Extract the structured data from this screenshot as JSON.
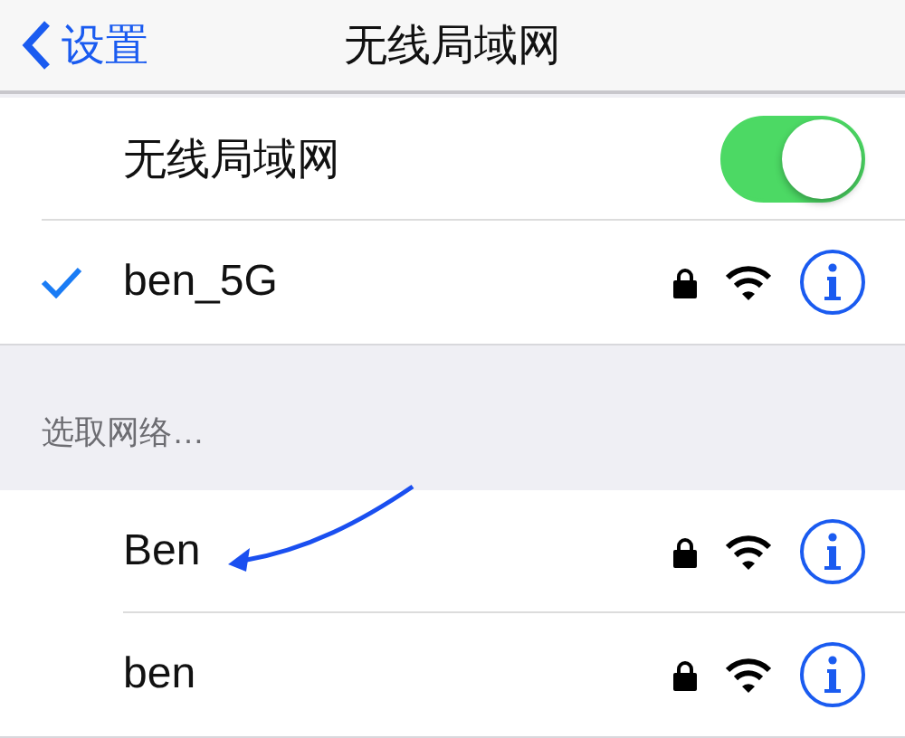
{
  "nav": {
    "back_label": "设置",
    "title": "无线局域网"
  },
  "wifi": {
    "label": "无线局域网",
    "on": true
  },
  "current": [
    {
      "name": "ben_5G",
      "selected": true,
      "locked": true
    }
  ],
  "section_header": "选取网络…",
  "networks": [
    {
      "name": "Ben",
      "selected": false,
      "locked": true
    },
    {
      "name": "ben",
      "selected": false,
      "locked": true
    }
  ],
  "annotation": {
    "kind": "arrow"
  }
}
